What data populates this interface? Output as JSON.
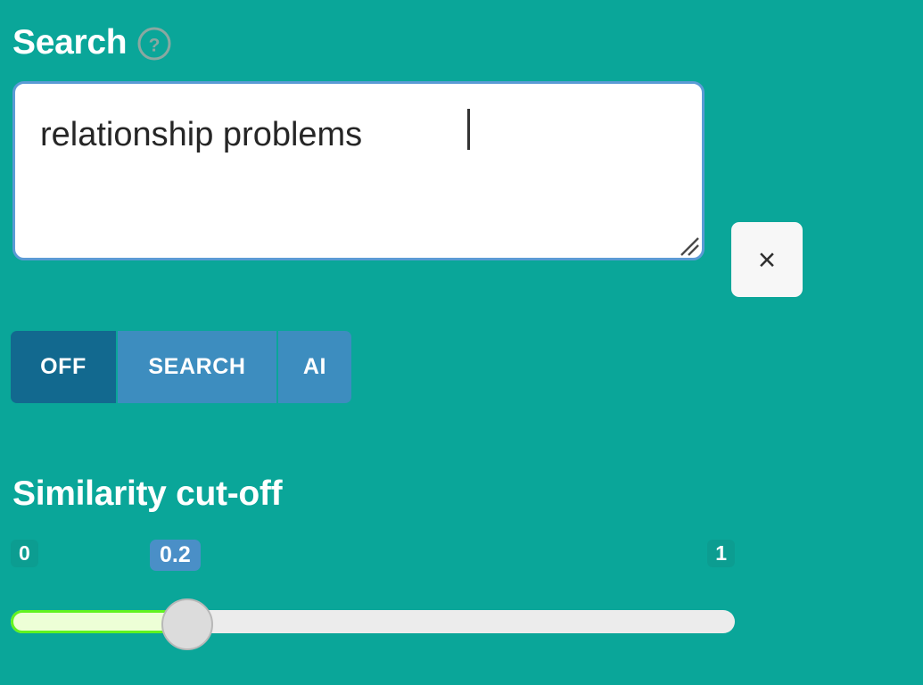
{
  "theme": {
    "background": "#0aa699",
    "accent_blue": "#3d8dbf",
    "accent_blue_active": "#12698f",
    "value_badge": "#4a8fc7",
    "slider_fill": "#61f321",
    "slider_fill_inner": "#edffd6",
    "slider_track": "#ececec",
    "focus_border": "#5b9bd5",
    "text_on_teal": "#ffffff"
  },
  "search": {
    "label": "Search",
    "help_icon": "question-mark-circle-icon",
    "value": "relationship problems",
    "placeholder": "",
    "clear_label": "×",
    "resize_grip_icon": "resize-handle-icon"
  },
  "mode_toggle": {
    "options": [
      {
        "label": "OFF",
        "active": true
      },
      {
        "label": "SEARCH",
        "active": false
      },
      {
        "label": "AI",
        "active": false
      }
    ],
    "selected": "OFF"
  },
  "similarity": {
    "title": "Similarity cut-off",
    "min_label": "0",
    "max_label": "1",
    "value_label": "0.2",
    "value": 0.2,
    "min": 0,
    "max": 1
  }
}
